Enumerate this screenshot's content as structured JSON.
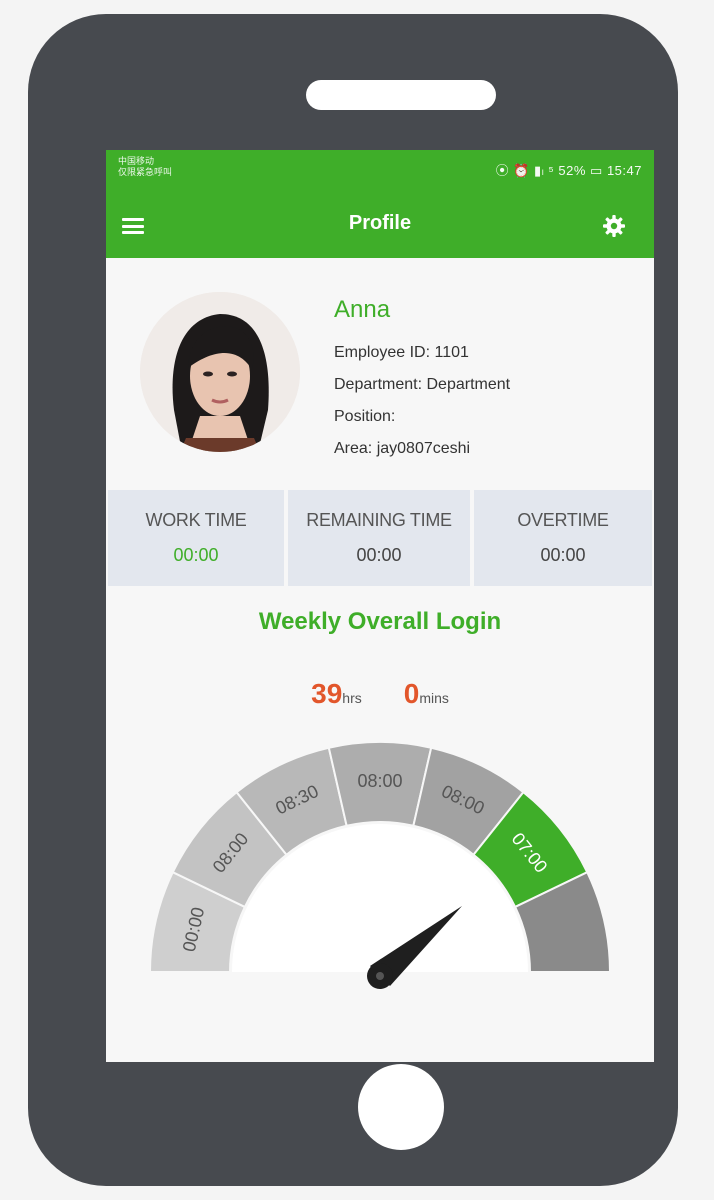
{
  "status_bar": {
    "carrier_line1": "中国移动",
    "carrier_line2": "仅限紧急呼叫",
    "indicators": "⦿ ⏰ ▮ₗ ⁵ 52% ▭ 15:47"
  },
  "appbar": {
    "title": "Profile",
    "menu_icon": "menu-icon",
    "settings_icon": "gear-icon",
    "color": "#3fae29"
  },
  "profile": {
    "name": "Anna",
    "employee_id": "Employee ID: 1101",
    "department": "Department: Department",
    "position": "Position:",
    "area": "Area: jay0807ceshi"
  },
  "stats": [
    {
      "label": "WORK TIME",
      "value": "00:00"
    },
    {
      "label": "REMAINING TIME",
      "value": "00:00"
    },
    {
      "label": "OVERTIME",
      "value": "00:00"
    }
  ],
  "weekly": {
    "title": "Weekly Overall Login",
    "hours": "39",
    "hours_unit": "hrs",
    "minutes": "0",
    "minutes_unit": "mins"
  },
  "gauge": {
    "segments": [
      "00:00",
      "08:00",
      "08:30",
      "08:00",
      "08:00",
      "07:00",
      ""
    ],
    "highlight_color": "#3fae29"
  }
}
